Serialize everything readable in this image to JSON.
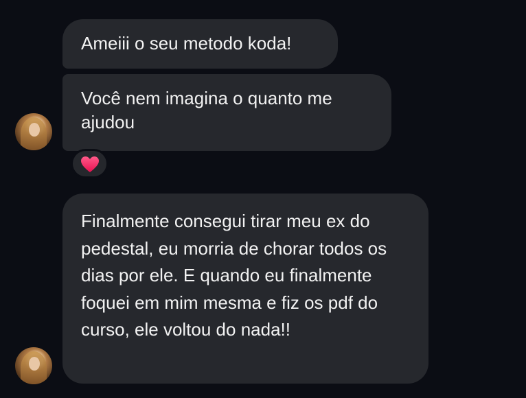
{
  "messages": [
    {
      "text": "Ameiii o seu metodo koda!"
    },
    {
      "text": "Você nem imagina o quanto me ajudou"
    },
    {
      "text": "Finalmente consegui tirar meu ex do pedestal, eu morria de chorar todos os dias por ele. E quando eu finalmente foquei em mim mesma e fiz os pdf do curso, ele voltou do nada!!"
    }
  ],
  "reaction": {
    "icon": "heart-icon",
    "color": "#ff2d6f"
  },
  "colors": {
    "background": "#0b0d14",
    "bubble": "#26282d",
    "text": "#f2f2f2"
  }
}
